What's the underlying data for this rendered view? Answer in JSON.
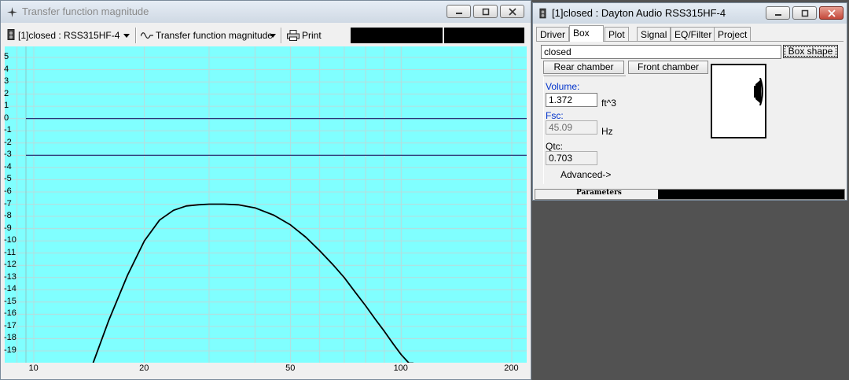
{
  "left_window": {
    "title": "Transfer function magnitude",
    "toolbar": {
      "driver_select": "[1]closed : RSS315HF-4",
      "plot_select": "Transfer function magnitude",
      "print_label": "Print"
    }
  },
  "right_window": {
    "title": "[1]closed : Dayton Audio RSS315HF-4",
    "tabs": [
      "Driver",
      "Box",
      "Plot",
      "Signal",
      "EQ/Filter",
      "Project"
    ],
    "active_tab": "Box",
    "box_name": "closed",
    "box_shape_label": "Box shape",
    "rear_chamber_label": "Rear chamber",
    "front_chamber_label": "Front chamber",
    "volume": {
      "label": "Volume:",
      "value": "1.372",
      "unit": "ft^3"
    },
    "fsc": {
      "label": "Fsc:",
      "value": "45.09",
      "unit": "Hz"
    },
    "qtc": {
      "label": "Qtc:",
      "value": "0.703"
    },
    "advanced_label": "Advanced->",
    "status": {
      "label": "Parameters"
    }
  },
  "chart_data": {
    "type": "line",
    "title": "",
    "xlabel": "",
    "ylabel": "",
    "xscale": "log",
    "xlim": [
      9,
      210
    ],
    "ylim": [
      -20,
      5.5
    ],
    "grid": true,
    "x_ticks": [
      "10",
      "20",
      "50",
      "100",
      "200"
    ],
    "y_ticks": [
      "5",
      "4",
      "3",
      "2",
      "1",
      "0",
      "-1",
      "-2",
      "-3",
      "-4",
      "-5",
      "-6",
      "-7",
      "-8",
      "-9",
      "-10",
      "-11",
      "-12",
      "-13",
      "-14",
      "-15",
      "-16",
      "-17",
      "-18",
      "-19"
    ],
    "reference_lines": [
      0,
      -3
    ],
    "background": "#80ffff",
    "series": [
      {
        "x": [
          14.5,
          16,
          18,
          20,
          22,
          24,
          26,
          28,
          30,
          33,
          36,
          40,
          45,
          50,
          55,
          60,
          65,
          70,
          75,
          80,
          85,
          90,
          95,
          100,
          105,
          108
        ],
        "y": [
          -20,
          -16.5,
          -12.8,
          -10.0,
          -8.3,
          -7.5,
          -7.15,
          -7.05,
          -7.0,
          -7.0,
          -7.05,
          -7.3,
          -7.9,
          -8.7,
          -9.7,
          -10.8,
          -11.9,
          -13.0,
          -14.2,
          -15.3,
          -16.4,
          -17.4,
          -18.4,
          -19.3,
          -20.0,
          -20.0
        ]
      }
    ]
  }
}
